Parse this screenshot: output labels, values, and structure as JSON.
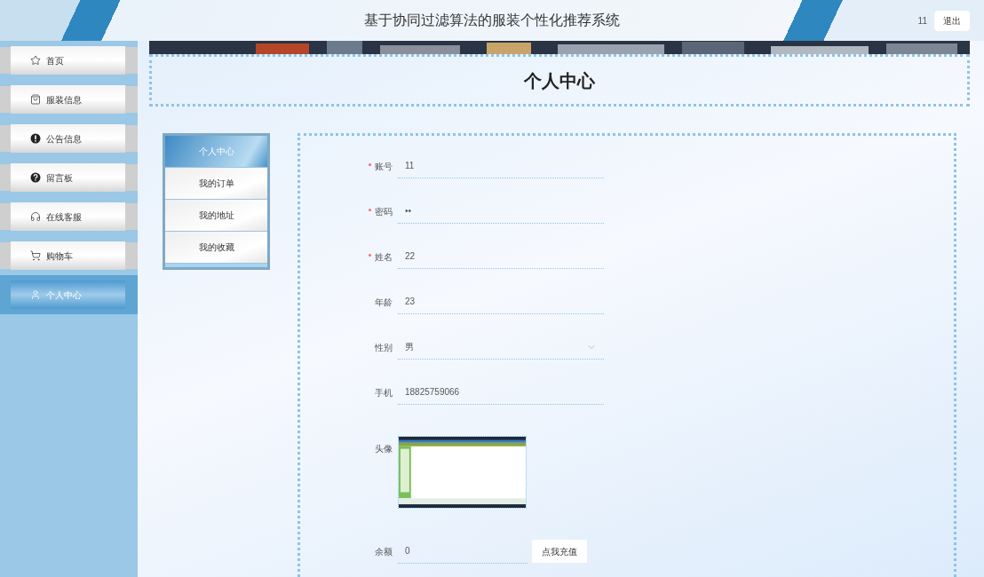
{
  "header": {
    "title": "基于协同过滤算法的服装个性化推荐系统",
    "user": "11",
    "logout": "退出"
  },
  "sidebar": {
    "items": [
      {
        "label": "首页",
        "selected": false
      },
      {
        "label": "服装信息",
        "selected": false
      },
      {
        "label": "公告信息",
        "selected": false
      },
      {
        "label": "留言板",
        "selected": false
      },
      {
        "label": "在线客服",
        "selected": false
      },
      {
        "label": "购物车",
        "selected": false
      },
      {
        "label": "个人中心",
        "selected": true
      }
    ]
  },
  "page_title": "个人中心",
  "submenu": [
    {
      "label": "个人中心",
      "selected": true
    },
    {
      "label": "我的订单",
      "selected": false
    },
    {
      "label": "我的地址",
      "selected": false
    },
    {
      "label": "我的收藏",
      "selected": false
    }
  ],
  "form": {
    "fields": [
      {
        "kind": "text",
        "label": "账号",
        "value": "11",
        "required": true
      },
      {
        "kind": "text",
        "label": "密码",
        "value": "••",
        "required": true
      },
      {
        "kind": "text",
        "label": "姓名",
        "value": "22",
        "required": true
      },
      {
        "kind": "text",
        "label": "年龄",
        "value": "23",
        "required": false
      },
      {
        "kind": "select",
        "label": "性别",
        "value": "男",
        "required": false
      },
      {
        "kind": "text",
        "label": "手机",
        "value": "18825759066",
        "required": false
      },
      {
        "label": "头像",
        "required": false
      },
      {
        "kind": "balance",
        "label": "余额",
        "value": "0",
        "required": false,
        "button": "点我充值"
      }
    ]
  }
}
